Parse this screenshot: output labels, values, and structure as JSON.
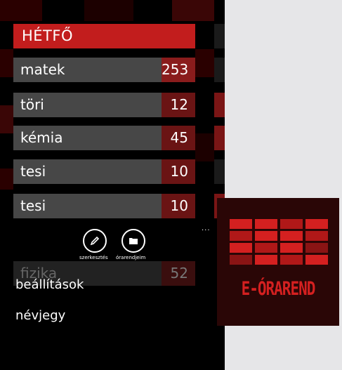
{
  "day": "HÉTFŐ",
  "lessons": [
    {
      "name": "matek",
      "count": "253"
    },
    {
      "name": "töri",
      "count": "12"
    },
    {
      "name": "kémia",
      "count": "45"
    },
    {
      "name": "tesi",
      "count": "10"
    },
    {
      "name": "tesi",
      "count": "10"
    }
  ],
  "ghost_row": {
    "name": "fizika",
    "count": "52"
  },
  "app_bar": {
    "edit_label": "szerkesztés",
    "timetables_label": "órarendjeim",
    "more": "..."
  },
  "menu": {
    "settings": "beállítások",
    "about": "névjegy"
  },
  "logo": {
    "text": "E-ÓRAREND",
    "colors": [
      "#d42020",
      "#b01818",
      "#8a1414"
    ]
  },
  "icons": {
    "edit": "pencil-icon",
    "timetables": "folder-icon"
  }
}
